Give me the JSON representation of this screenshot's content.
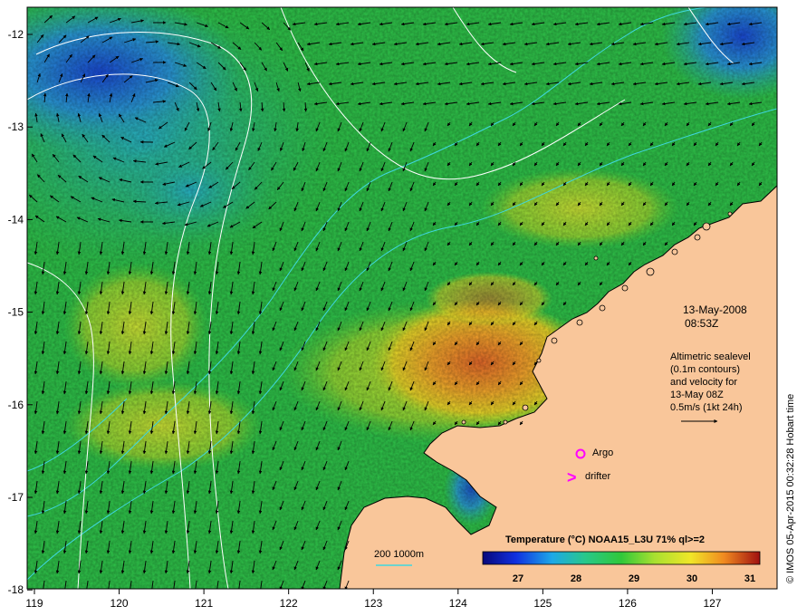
{
  "map": {
    "date": "13-May-2008",
    "time": "08:53Z",
    "description_lines": [
      "Altimetric sealevel",
      "(0.1m contours)",
      "and velocity for",
      "13-May 08Z",
      "0.5m/s (1kt 24h)"
    ],
    "credit": "© IMOS 05-Apr-2015 00:32:28 Hobart time",
    "legend_argo": "Argo",
    "legend_drifter": "drifter",
    "drifter_symbol": ">",
    "depth_label": "200  1000m",
    "colorbar_title": "Temperature (°C) NOAA15_L3U 71% ql>=2",
    "colorbar_ticks": [
      "27",
      "28",
      "29",
      "30",
      "31"
    ],
    "x_ticks": [
      "119",
      "120",
      "121",
      "122",
      "123",
      "124",
      "125",
      "126",
      "127"
    ],
    "y_ticks": [
      "-12",
      "-13",
      "-14",
      "-15",
      "-16",
      "-17",
      "-18"
    ],
    "colors": {
      "land": "#f9c69a",
      "ocean_mid": "#2fc44a",
      "warm": "#f0a030",
      "cool": "#25a3d8",
      "argo": "#ff00ff",
      "contour": "#ffffff",
      "bathy": "#3fd7e0"
    }
  }
}
